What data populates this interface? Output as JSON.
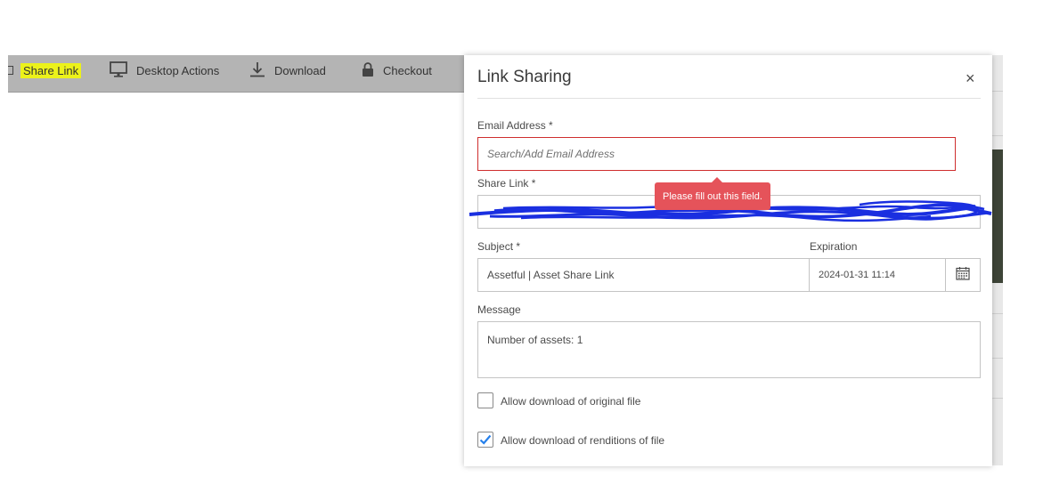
{
  "toolbar": {
    "share_link": "Share Link",
    "desktop_actions": "Desktop Actions",
    "download": "Download",
    "checkout": "Checkout"
  },
  "modal": {
    "title": "Link Sharing",
    "close": "×",
    "email": {
      "label": "Email Address *",
      "placeholder": "Search/Add Email Address"
    },
    "validation_tooltip": "Please fill out this field.",
    "share_link": {
      "label": "Share Link *"
    },
    "subject": {
      "label": "Subject *",
      "value": "Assetful | Asset Share Link"
    },
    "expiration": {
      "label": "Expiration",
      "value": "2024-01-31 11:14"
    },
    "message": {
      "label": "Message",
      "value": "Number of assets: 1"
    },
    "options": [
      {
        "label": "Allow download of original file",
        "checked": false
      },
      {
        "label": "Allow download of renditions of file",
        "checked": true
      }
    ]
  },
  "colors": {
    "highlight": "#ecf21a",
    "error": "#cf2e2e",
    "tooltip": "#e5535a",
    "check": "#2680eb",
    "redaction": "#1a2fe0"
  }
}
